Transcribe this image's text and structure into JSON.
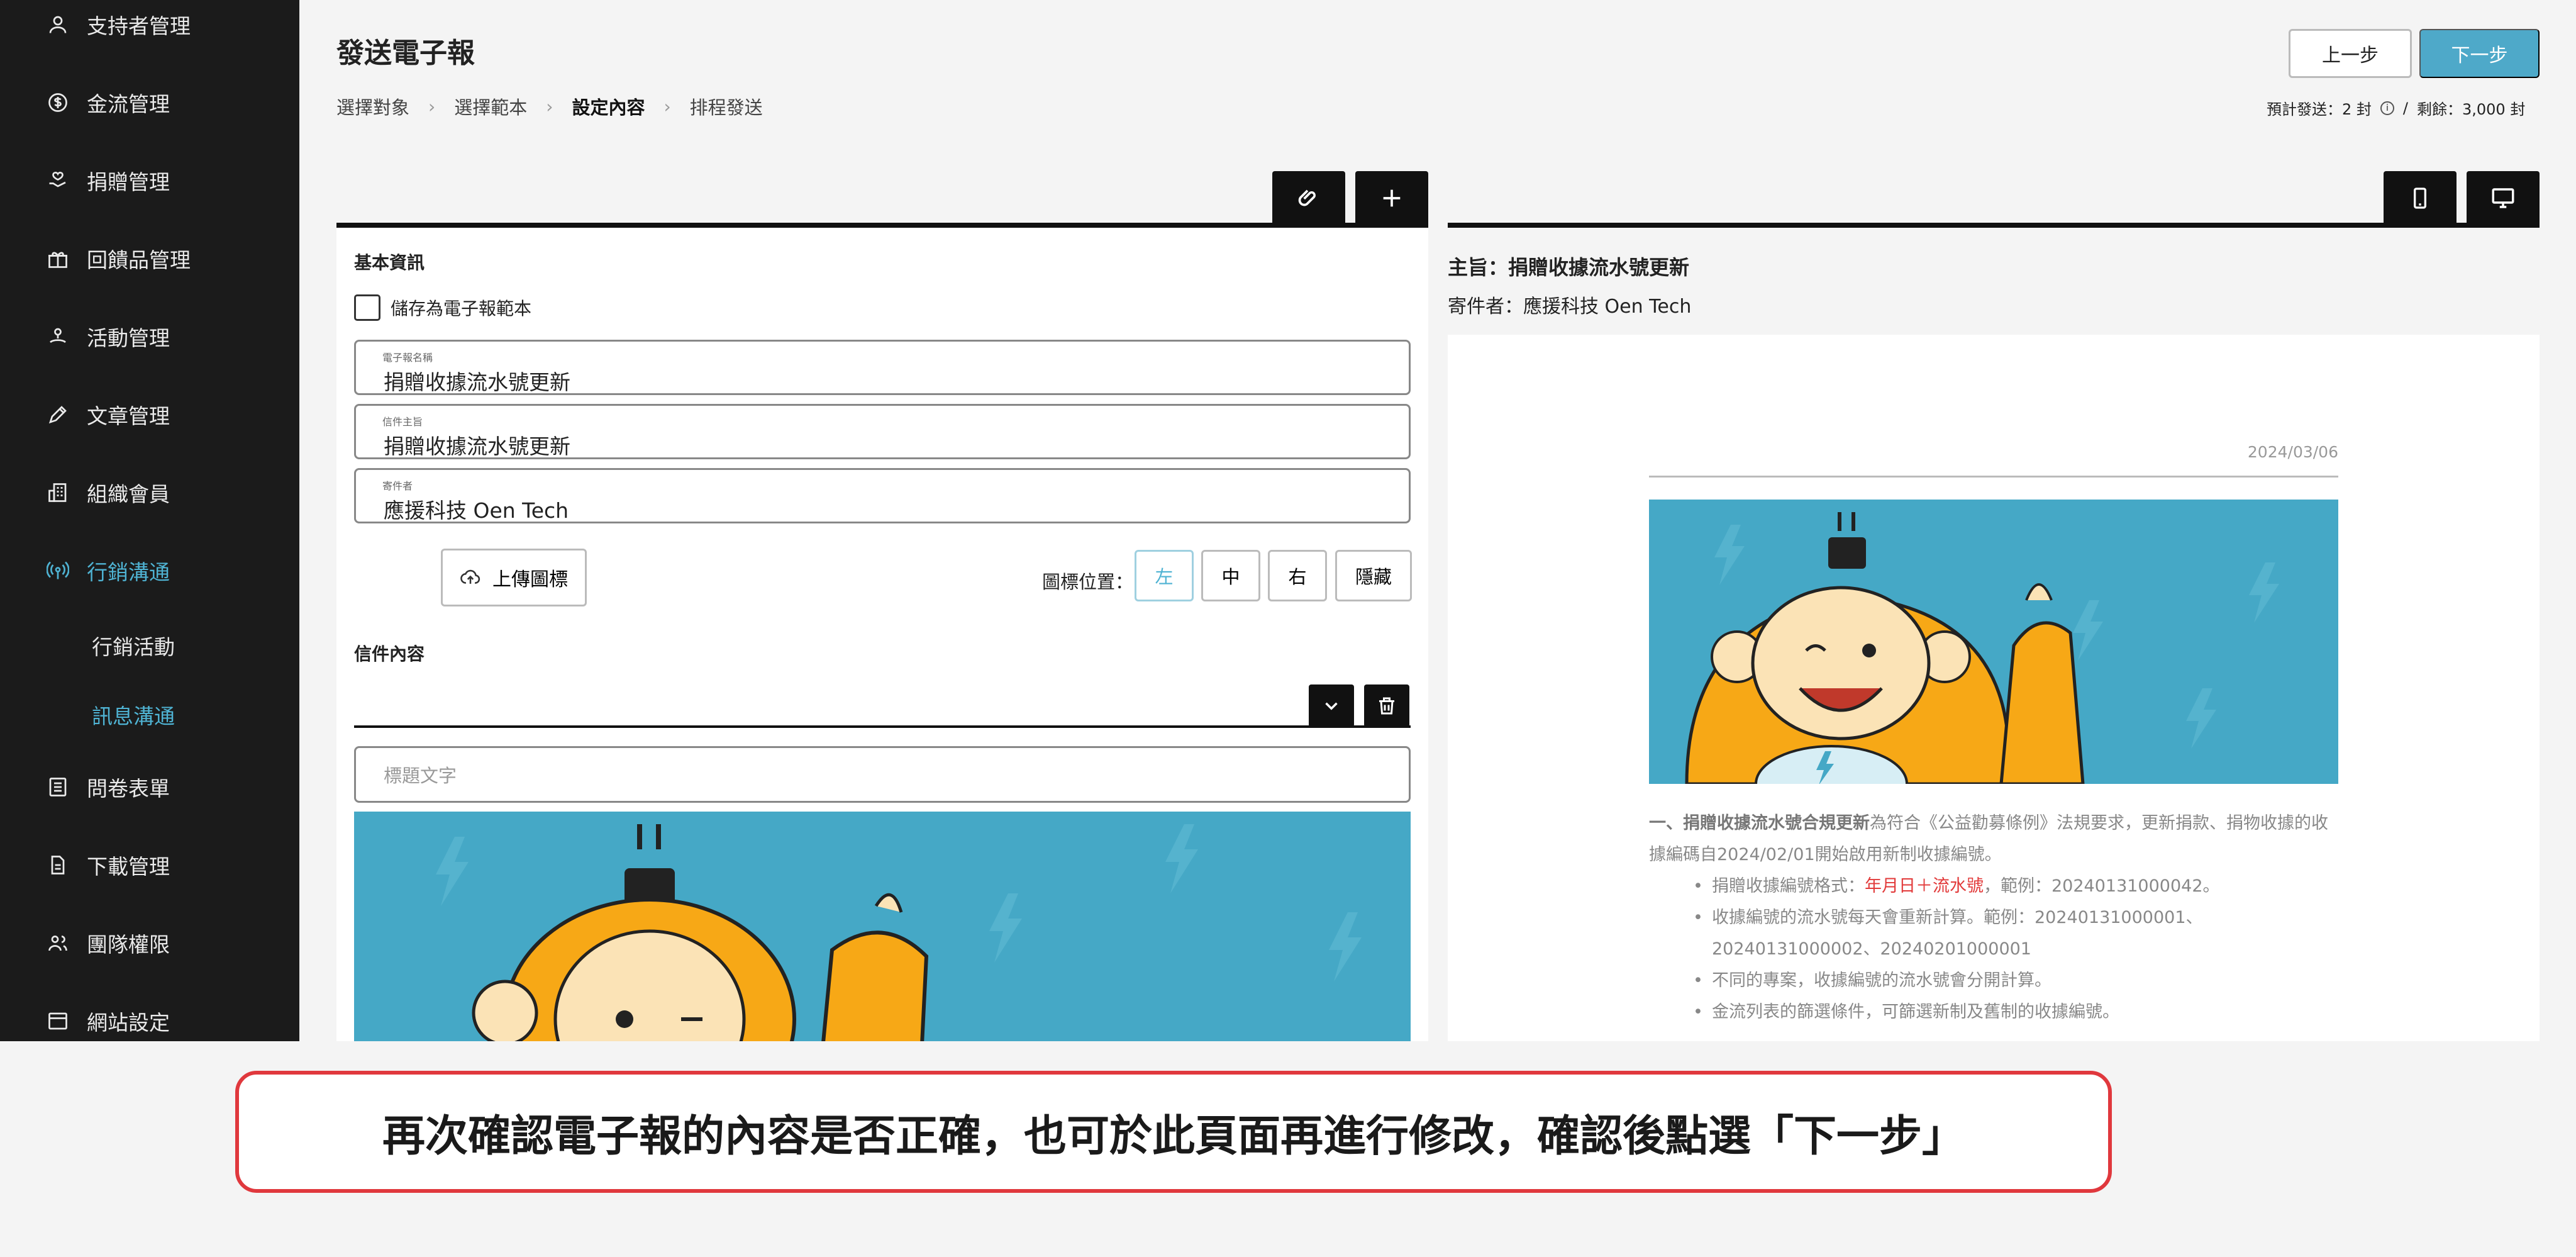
{
  "sidebar": {
    "items": [
      {
        "label": "支持者管理",
        "icon": "person-icon"
      },
      {
        "label": "金流管理",
        "icon": "dollar-circle-icon"
      },
      {
        "label": "捐贈管理",
        "icon": "hand-heart-icon"
      },
      {
        "label": "回饋品管理",
        "icon": "gift-icon"
      },
      {
        "label": "活動管理",
        "icon": "location-hand-icon"
      },
      {
        "label": "文章管理",
        "icon": "pen-icon"
      },
      {
        "label": "組織會員",
        "icon": "building-icon"
      },
      {
        "label": "行銷溝通",
        "icon": "broadcast-icon"
      },
      {
        "label": "問卷表單",
        "icon": "list-form-icon"
      },
      {
        "label": "下載管理",
        "icon": "document-icon"
      },
      {
        "label": "團隊權限",
        "icon": "team-icon"
      },
      {
        "label": "網站設定",
        "icon": "browser-icon"
      }
    ],
    "sub_items": [
      "行銷活動",
      "訊息溝通"
    ],
    "active_item": "行銷溝通",
    "active_sub": "訊息溝通",
    "accent_color": "#4fb3d3"
  },
  "header": {
    "title": "發送電子報",
    "steps": [
      "選擇對象",
      "選擇範本",
      "設定內容",
      "排程發送"
    ],
    "current_step": "設定內容",
    "prev_label": "上一步",
    "next_label": "下一步",
    "quota_expected": "預計發送：2 封",
    "quota_sep": "/",
    "quota_remaining": "剩餘：3,000 封"
  },
  "editor": {
    "basic_info_label": "基本資訊",
    "save_template_label": "儲存為電子報範本",
    "fields": {
      "name": {
        "label": "電子報名稱",
        "value": "捐贈收據流水號更新"
      },
      "subject": {
        "label": "信件主旨",
        "value": "捐贈收據流水號更新"
      },
      "sender": {
        "label": "寄件者",
        "value": "應援科技 Oen Tech"
      }
    },
    "upload_label": "上傳圖標",
    "icon_position_label": "圖標位置：",
    "icon_positions": [
      "左",
      "中",
      "右",
      "隱藏"
    ],
    "selected_position": "左",
    "content_label": "信件內容",
    "title_placeholder": "標題文字"
  },
  "preview": {
    "subject_line": "主旨：捐贈收據流水號更新",
    "sender_line": "寄件者：應援科技 Oen Tech",
    "date": "2024/03/06",
    "para_bold": "一、捐贈收據流水號合規更新",
    "para_rest": "為符合《公益勸募條例》法規要求，更新捐款、捐物收據的收據編碼自2024/02/01開始啟用新制收據編號。",
    "bullets": [
      {
        "pre": "捐贈收據編號格式：",
        "red": "年月日＋流水號",
        "post": "，範例：20240131000042。"
      },
      {
        "pre": "收據編號的流水號每天會重新計算。範例：20240131000001、20240131000002、20240201000001",
        "red": "",
        "post": ""
      },
      {
        "pre": "不同的專案，收據編號的流水號會分開計算。",
        "red": "",
        "post": ""
      },
      {
        "pre": "金流列表的篩選條件，可篩選新制及舊制的收據編號。",
        "red": "",
        "post": ""
      }
    ]
  },
  "caption": "再次確認電子報的內容是否正確，也可於此頁面再進行修改，確認後點選「下一步」"
}
